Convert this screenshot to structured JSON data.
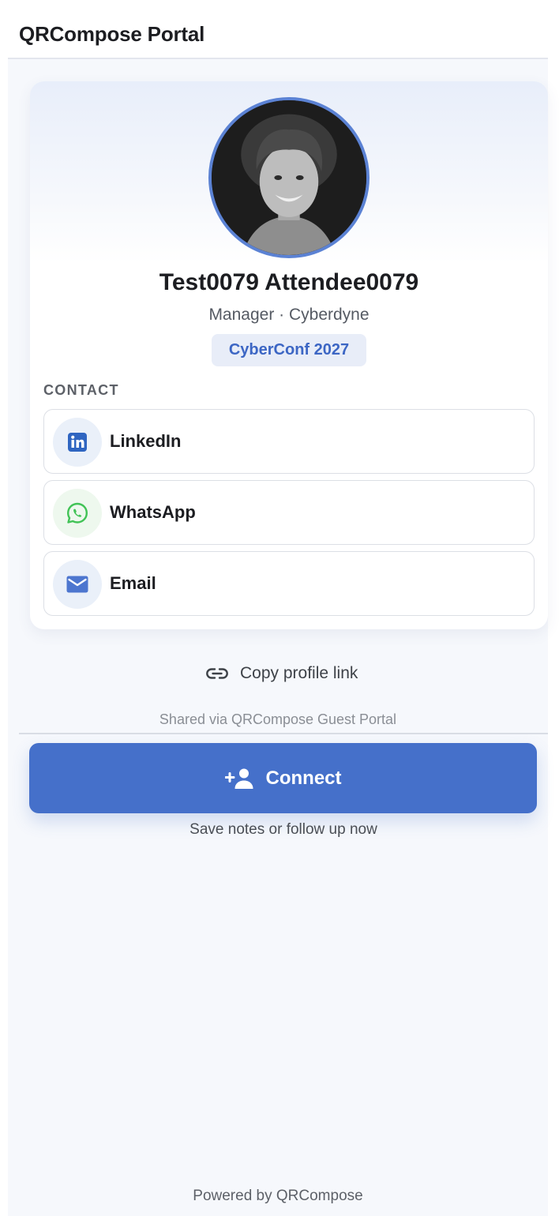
{
  "app": {
    "title": "QRCompose Portal"
  },
  "profile": {
    "name": "Test0079 Attendee0079",
    "subtitle": "Manager · Cyberdyne",
    "event": "CyberConf 2027"
  },
  "contact": {
    "section_label": "CONTACT",
    "items": [
      {
        "label": "LinkedIn",
        "icon": "linkedin-icon",
        "color": "#2f65c1",
        "icon_bg": "#eaf0f9"
      },
      {
        "label": "WhatsApp",
        "icon": "whatsapp-icon",
        "color": "#41c356",
        "icon_bg": "#eef8ee"
      },
      {
        "label": "Email",
        "icon": "mail-icon",
        "color": "#4d76cf",
        "icon_bg": "#eaf0f9"
      }
    ]
  },
  "actions": {
    "copy_link": "Copy profile link",
    "shared_note": "Shared via QRCompose Guest Portal",
    "connect_label": "Connect",
    "connect_note": "Save notes or follow up now"
  },
  "footer": {
    "text": "Powered by QRCompose"
  },
  "colors": {
    "accent": "#4570ca",
    "avatar_ring": "#5b82d4",
    "badge_bg": "#e8edf8",
    "badge_text": "#3c66c4"
  }
}
